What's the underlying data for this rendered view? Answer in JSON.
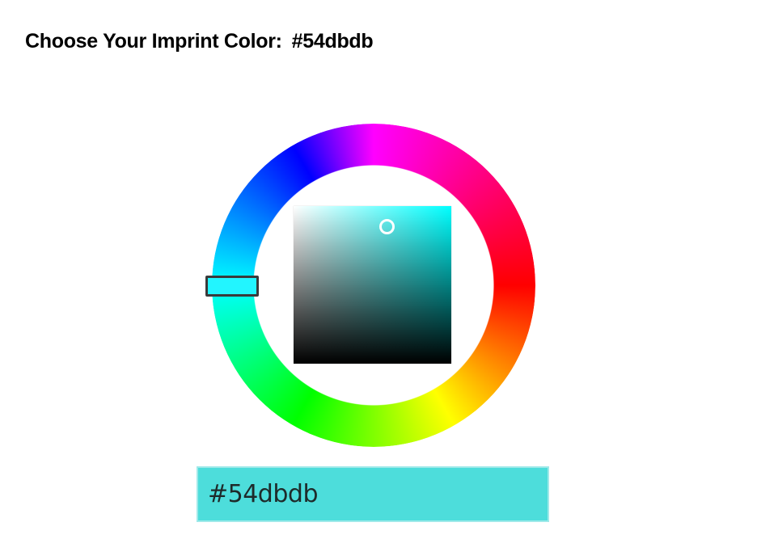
{
  "heading": {
    "label": "Choose Your Imprint Color:",
    "value": "#54dbdb"
  },
  "color_picker": {
    "hue_ring_colors": [
      "#ff00ff",
      "#ff0000",
      "#ffff00",
      "#00ff00",
      "#00ffff",
      "#0000ff"
    ],
    "selected_hue_color": "#00ffff",
    "selected_color": "#54dbdb"
  },
  "hex_input": {
    "value": "#54dbdb",
    "background": "#54dbdb"
  }
}
